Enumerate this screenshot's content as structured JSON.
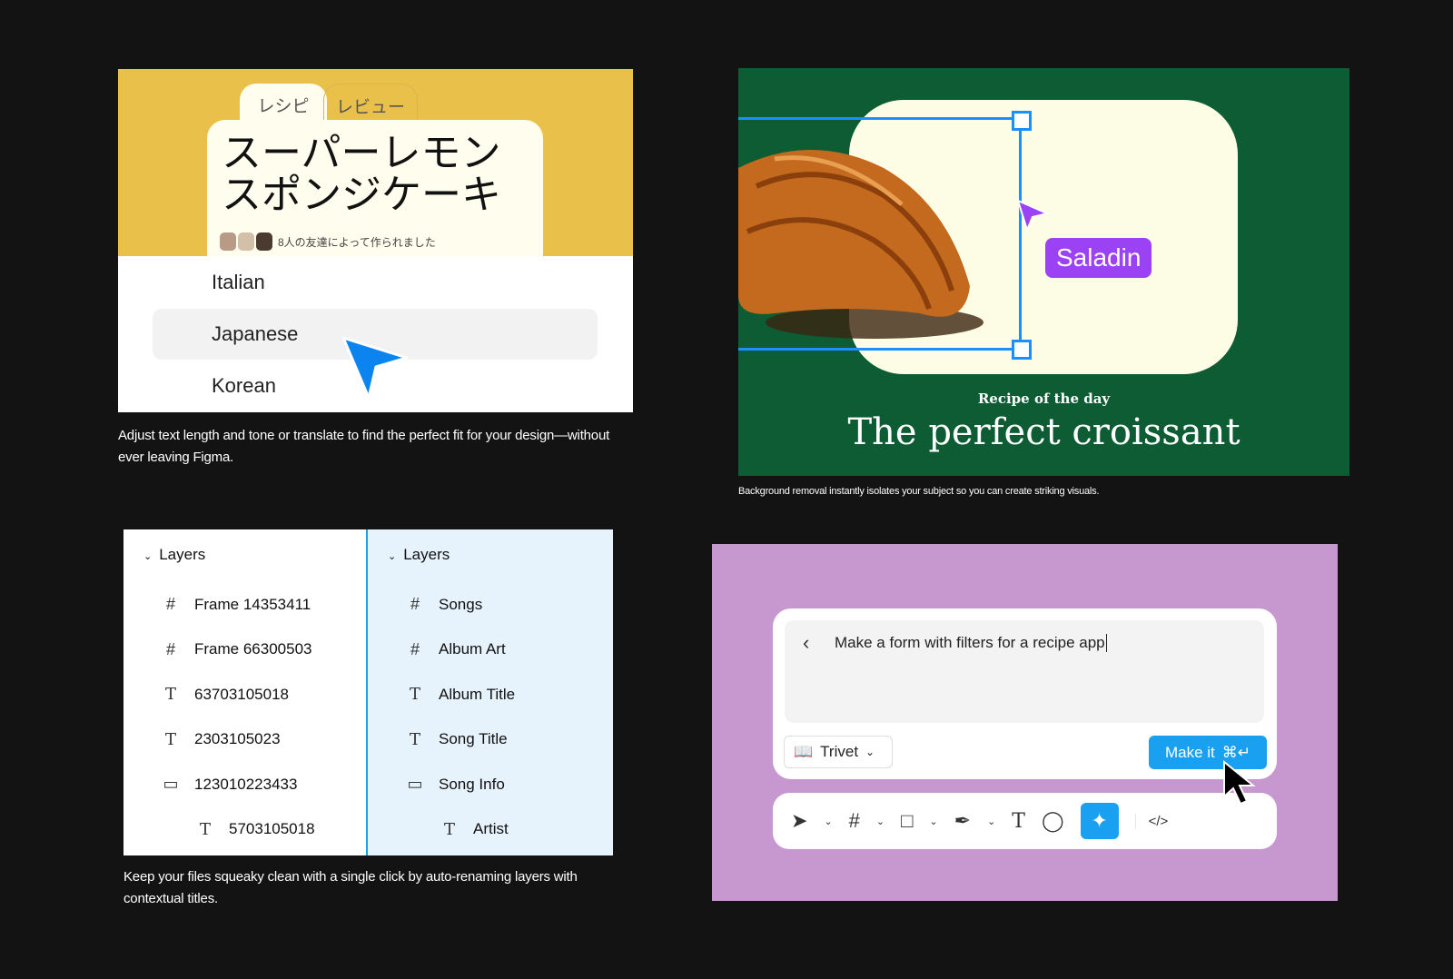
{
  "panel1": {
    "tabs": [
      {
        "label": "レシピ"
      },
      {
        "label": "レビュー"
      }
    ],
    "title_line1": "スーパーレモン",
    "title_line2": "スポンジケーキ",
    "friends_text": "8人の友達によって作られました",
    "languages": [
      {
        "label": "Italian"
      },
      {
        "label": "Japanese",
        "selected": true
      },
      {
        "label": "Korean"
      }
    ],
    "caption": "Adjust text length and tone or translate to find the perfect fit for your design—without ever leaving Figma."
  },
  "panel2": {
    "cursor_label": "Saladin",
    "eyebrow": "Recipe of the day",
    "headline": "The perfect croissant",
    "caption": "Background removal instantly isolates your subject so you can create striking visuals."
  },
  "panel3": {
    "before": {
      "header": "Layers",
      "items": [
        {
          "icon": "frame-icon",
          "label": "Frame 14353411"
        },
        {
          "icon": "frame-icon",
          "label": "Frame 66300503"
        },
        {
          "icon": "text-icon",
          "label": "63703105018"
        },
        {
          "icon": "text-icon",
          "label": "2303105023"
        },
        {
          "icon": "component-icon",
          "label": "123010223433"
        },
        {
          "icon": "text-icon",
          "label": "5703105018",
          "indent": true
        }
      ]
    },
    "after": {
      "header": "Layers",
      "items": [
        {
          "icon": "frame-icon",
          "label": "Songs"
        },
        {
          "icon": "frame-icon",
          "label": "Album Art"
        },
        {
          "icon": "text-icon",
          "label": "Album Title"
        },
        {
          "icon": "text-icon",
          "label": "Song Title"
        },
        {
          "icon": "component-icon",
          "label": "Song Info"
        },
        {
          "icon": "text-icon",
          "label": "Artist",
          "indent": true
        }
      ]
    },
    "caption": "Keep your files squeaky clean with a single click by auto-renaming layers with contextual titles."
  },
  "panel4": {
    "prompt": "Make a form with filters for a recipe app",
    "library": "Trivet",
    "make_button": "Make it",
    "shortcut": "⌘↵",
    "accent": "#1aa0f0"
  }
}
